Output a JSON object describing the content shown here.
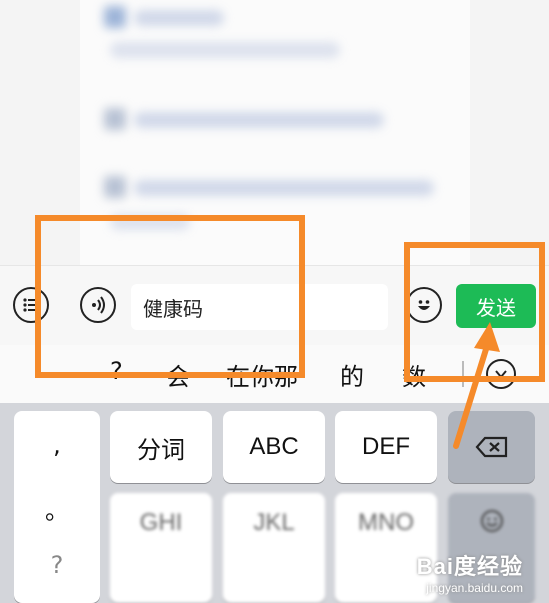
{
  "input_bar": {
    "message_text": "健康码",
    "send_label": "发送"
  },
  "candidates": {
    "items": [
      "?",
      "会",
      "在你那",
      "的",
      "数"
    ]
  },
  "keyboard": {
    "punctuation": [
      ",",
      "。",
      "?"
    ],
    "row1": [
      "分词",
      "ABC",
      "DEF"
    ],
    "row2": [
      "GHI",
      "JKL",
      "MNO"
    ]
  },
  "watermark": {
    "logo": "Bai度经验",
    "url": "jingyan.baidu.com"
  },
  "colors": {
    "send_green": "#1dbb56",
    "annotation_orange": "#f58a2a"
  },
  "icons": {
    "left": "list-icon",
    "voice": "voice-icon",
    "emoji": "emoji-icon",
    "delete": "backspace-icon",
    "candidate_more": "chevron-down-icon"
  }
}
